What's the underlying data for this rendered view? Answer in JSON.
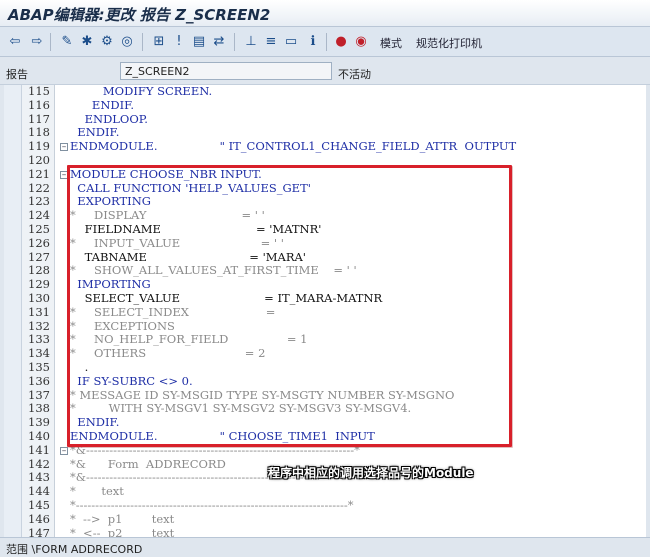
{
  "title": "ABAP编辑器:更改 报告 Z_SCREEN2",
  "toolbar": {
    "mode_label": "模式",
    "pretty_printer_label": "规范化打印机"
  },
  "fieldbar": {
    "label": "报告",
    "value": "Z_SCREEN2",
    "status": "不活动"
  },
  "code_lines": [
    {
      "num": "115",
      "text": "         MODIFY SCREEN.",
      "kind": "kw"
    },
    {
      "num": "116",
      "text": "      ENDIF.",
      "kind": "kw"
    },
    {
      "num": "117",
      "text": "    ENDLOOP.",
      "kind": "kw"
    },
    {
      "num": "118",
      "text": "  ENDIF.",
      "kind": "kw"
    },
    {
      "num": "119",
      "text": "ENDMODULE.                 \" IT_CONTROL1_CHANGE_FIELD_ATTR  OUTPUT",
      "kind": "kw"
    },
    {
      "num": "120",
      "text": "",
      "kind": "df"
    },
    {
      "num": "121",
      "text": "MODULE CHOOSE_NBR INPUT.",
      "kind": "kw"
    },
    {
      "num": "122",
      "text": "  CALL FUNCTION 'HELP_VALUES_GET'",
      "kind": "kw"
    },
    {
      "num": "123",
      "text": "  EXPORTING",
      "kind": "kw"
    },
    {
      "num": "124",
      "text": "*     DISPLAY                          = ' '",
      "kind": "cm"
    },
    {
      "num": "125",
      "text": "    FIELDNAME                          = 'MATNR'",
      "kind": "df"
    },
    {
      "num": "126",
      "text": "*     INPUT_VALUE                      = ' '",
      "kind": "cm"
    },
    {
      "num": "127",
      "text": "    TABNAME                            = 'MARA'",
      "kind": "df"
    },
    {
      "num": "128",
      "text": "*     SHOW_ALL_VALUES_AT_FIRST_TIME    = ' '",
      "kind": "cm"
    },
    {
      "num": "129",
      "text": "  IMPORTING",
      "kind": "kw"
    },
    {
      "num": "130",
      "text": "    SELECT_VALUE                       = IT_MARA-MATNR",
      "kind": "df"
    },
    {
      "num": "131",
      "text": "*     SELECT_INDEX                     =",
      "kind": "cm"
    },
    {
      "num": "132",
      "text": "*     EXCEPTIONS",
      "kind": "cm"
    },
    {
      "num": "133",
      "text": "*     NO_HELP_FOR_FIELD                = 1",
      "kind": "cm"
    },
    {
      "num": "134",
      "text": "*     OTHERS                           = 2",
      "kind": "cm"
    },
    {
      "num": "135",
      "text": "    .",
      "kind": "df"
    },
    {
      "num": "136",
      "text": "  IF SY-SUBRC <> 0.",
      "kind": "kw"
    },
    {
      "num": "137",
      "text": "* MESSAGE ID SY-MSGID TYPE SY-MSGTY NUMBER SY-MSGNO",
      "kind": "cm"
    },
    {
      "num": "138",
      "text": "*         WITH SY-MSGV1 SY-MSGV2 SY-MSGV3 SY-MSGV4.",
      "kind": "cm"
    },
    {
      "num": "139",
      "text": "  ENDIF.",
      "kind": "kw"
    },
    {
      "num": "140",
      "text": "ENDMODULE.                 \" CHOOSE_TIME1  INPUT",
      "kind": "kw"
    },
    {
      "num": "141",
      "text": "*&---------------------------------------------------------------------*",
      "kind": "cm"
    },
    {
      "num": "142",
      "text": "*&      Form  ADDRECORD",
      "kind": "cm"
    },
    {
      "num": "143",
      "text": "*&---------------------------------------------------------------------*",
      "kind": "cm"
    },
    {
      "num": "144",
      "text": "*       text",
      "kind": "cm"
    },
    {
      "num": "145",
      "text": "*----------------------------------------------------------------------*",
      "kind": "cm"
    },
    {
      "num": "146",
      "text": "*  -->  p1        text",
      "kind": "cm"
    },
    {
      "num": "147",
      "text": "*  <--  p2        text",
      "kind": "cm"
    }
  ],
  "annotation": "程序中相应的调用选择品号的Module",
  "statusbar": "范围 \\FORM ADDRECORD",
  "colors": {
    "keyword": "#1f2fa6",
    "comment": "#8a8a8a",
    "highlight": "#d8202a"
  },
  "icons": [
    "back-icon",
    "forward-icon",
    "check-icon",
    "activate-icon",
    "test-icon",
    "where-used-icon",
    "object-list-icon",
    "insert-icon",
    "pattern-icon",
    "pretty-print-icon",
    "hierarchy-icon",
    "info-icon",
    "breakpoint-icon",
    "session-breakpoint-icon"
  ]
}
